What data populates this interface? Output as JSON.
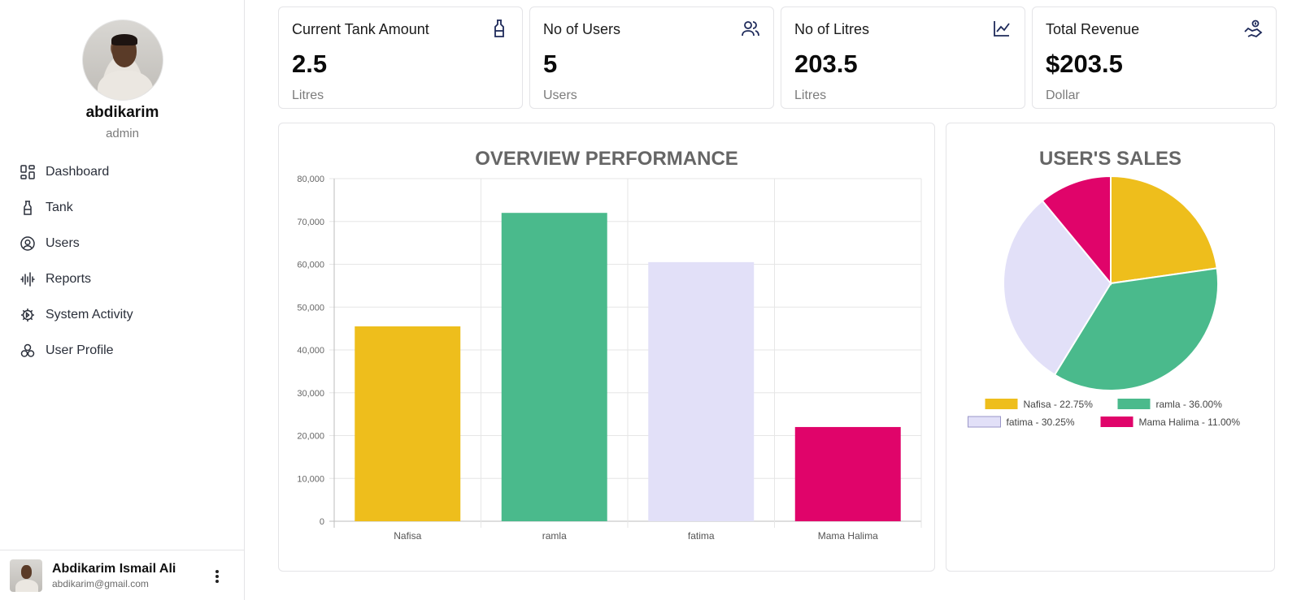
{
  "sidebar": {
    "profile": {
      "name": "abdikarim",
      "role": "admin"
    },
    "items": [
      {
        "label": "Dashboard",
        "icon": "dashboard-icon"
      },
      {
        "label": "Tank",
        "icon": "tank-icon"
      },
      {
        "label": "Users",
        "icon": "user-circle-icon"
      },
      {
        "label": "Reports",
        "icon": "reports-icon"
      },
      {
        "label": "System Activity",
        "icon": "gear-icon"
      },
      {
        "label": "User Profile",
        "icon": "user-profile-icon"
      }
    ],
    "footer": {
      "name": "Abdikarim Ismail Ali",
      "email": "abdikarim@gmail.com"
    }
  },
  "stats": [
    {
      "title": "Current Tank Amount",
      "value": "2.5",
      "unit": "Litres",
      "icon": "bottle-icon"
    },
    {
      "title": "No of Users",
      "value": "5",
      "unit": "Users",
      "icon": "users-icon"
    },
    {
      "title": "No of Litres",
      "value": "203.5",
      "unit": "Litres",
      "icon": "line-chart-icon"
    },
    {
      "title": "Total Revenue",
      "value": "$203.5",
      "unit": "Dollar",
      "icon": "revenue-icon"
    }
  ],
  "colors": {
    "accent_icon": "#1e2a5a",
    "nafisa": "#eebe1c",
    "ramla": "#4aba8c",
    "fatima": "#e2e0f8",
    "mama_halima": "#e0046a"
  },
  "chart_data": [
    {
      "type": "bar",
      "title": "OVERVIEW PERFORMANCE",
      "categories": [
        "Nafisa",
        "ramla",
        "fatima",
        "Mama Halima"
      ],
      "values": [
        45500,
        72000,
        60500,
        22000
      ],
      "colors": [
        "#eebe1c",
        "#4aba8c",
        "#e2e0f8",
        "#e0046a"
      ],
      "ylim": [
        0,
        80000
      ],
      "yticks": [
        "0",
        "10,000",
        "20,000",
        "30,000",
        "40,000",
        "50,000",
        "60,000",
        "70,000",
        "80,000"
      ],
      "grid": true
    },
    {
      "type": "pie",
      "title": "USER'S SALES",
      "labels": [
        "Nafisa",
        "ramla",
        "fatima",
        "Mama Halima"
      ],
      "values": [
        22.75,
        36.0,
        30.25,
        11.0
      ],
      "legend": [
        "Nafisa - 22.75%",
        "ramla - 36.00%",
        "fatima - 30.25%",
        "Mama Halima - 11.00%"
      ],
      "colors": [
        "#eebe1c",
        "#4aba8c",
        "#e2e0f8",
        "#e0046a"
      ],
      "legend_position": "bottom"
    }
  ]
}
